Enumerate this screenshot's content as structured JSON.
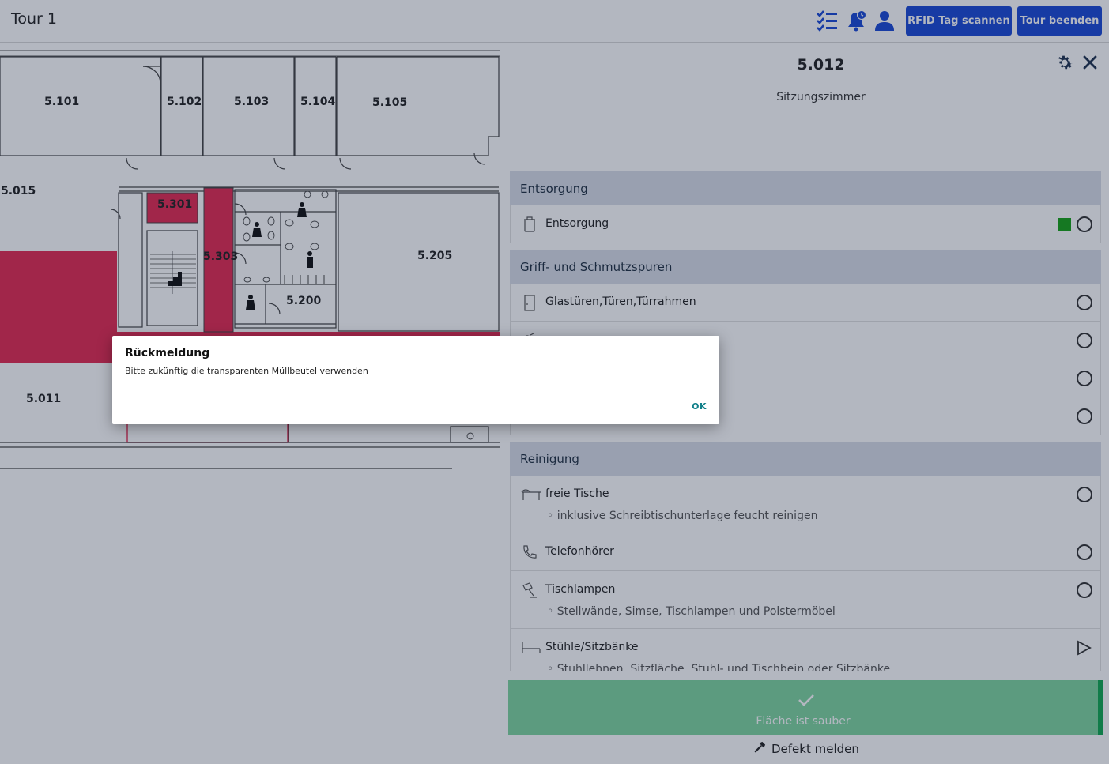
{
  "header": {
    "title": "Tour 1",
    "buttons": {
      "scan_rfid": "RFID Tag scannen",
      "end_tour": "Tour beenden"
    },
    "icons": [
      "checklist-icon",
      "notification-bell-icon",
      "user-icon"
    ]
  },
  "floorplan": {
    "rooms": [
      "5.101",
      "5.102",
      "5.103",
      "5.104",
      "5.105",
      "5.015",
      "5.301",
      "5.303",
      "5.205",
      "5.200",
      "5.011"
    ],
    "highlight_color": "#e52a52"
  },
  "panel": {
    "room_number": "5.012",
    "room_name": "Sitzungszimmer",
    "sections": [
      {
        "title": "Entsorgung",
        "items": [
          {
            "label": "Entsorgung",
            "icon": "trash-bin-icon",
            "status": "green"
          }
        ]
      },
      {
        "title": "Griff- und Schmutzspuren",
        "items": [
          {
            "label": "Glastüren,Türen,Türrahmen",
            "icon": "door-icon"
          },
          {
            "label": "",
            "icon": "switch-icon"
          },
          {
            "label": "",
            "icon": "handle-icon"
          },
          {
            "label": "",
            "icon": "wipe-icon"
          }
        ]
      },
      {
        "title": "Reinigung",
        "items": [
          {
            "label": "freie Tische",
            "sub": "◦ inklusive Schreibtischunterlage feucht reinigen",
            "icon": "table-icon"
          },
          {
            "label": "Telefonhörer",
            "icon": "phone-icon"
          },
          {
            "label": "Tischlampen",
            "sub": "◦ Stellwände, Simse, Tischlampen und Polstermöbel",
            "icon": "lamp-icon"
          },
          {
            "label": "Stühle/Sitzbänke",
            "sub": "◦ Stuhllehnen, Sitzfläche, Stuhl- und Tischbein oder Sitzbänke",
            "icon": "bench-icon",
            "action": "play"
          }
        ]
      }
    ],
    "done_button": "Fläche ist sauber",
    "defect_link": "Defekt melden",
    "accent_green": "#10a850"
  },
  "dialog": {
    "title": "Rückmeldung",
    "message": "Bitte zukünftig die transparenten Müllbeutel verwenden",
    "ok_label": "OK"
  }
}
